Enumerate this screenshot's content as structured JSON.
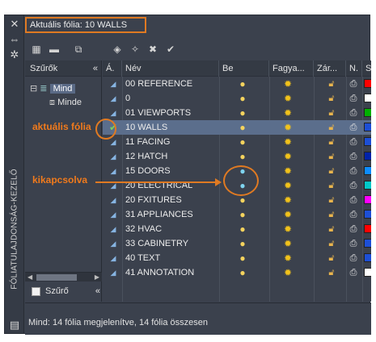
{
  "current_layer_label": "Aktuális fólia: 10 WALLS",
  "vertical_title": "FÓLIATULAJDONSÁG-KEZELŐ",
  "filters": {
    "header": "Szűrők",
    "collapse": "«",
    "tree": [
      {
        "label": "Mind",
        "selected": true
      },
      {
        "label": "Minde"
      }
    ],
    "invert_label": "Szűrő",
    "invert_collapse": "«"
  },
  "columns": [
    {
      "label": "Á."
    },
    {
      "label": "Név"
    },
    {
      "label": "Be"
    },
    {
      "label": "Fagya..."
    },
    {
      "label": "Zár..."
    },
    {
      "label": "N."
    },
    {
      "label": "Szí"
    }
  ],
  "layers": [
    {
      "name": "00 REFERENCE",
      "on": true,
      "color": "#ff0000",
      "current": false
    },
    {
      "name": "0",
      "on": true,
      "color": "#ffffff",
      "current": false
    },
    {
      "name": "01 VIEWPORTS",
      "on": true,
      "color": "#00b000",
      "current": false
    },
    {
      "name": "10 WALLS",
      "on": true,
      "color": "#1d4fd6",
      "current": true
    },
    {
      "name": "11 FACING",
      "on": true,
      "color": "#1d4fd6",
      "current": false
    },
    {
      "name": "12 HATCH",
      "on": true,
      "color": "#0022aa",
      "current": false
    },
    {
      "name": "15 DOORS",
      "on": false,
      "color": "#0d8cff",
      "current": false
    },
    {
      "name": "20 ELECTRICAL",
      "on": false,
      "color": "#00c8c8",
      "current": false
    },
    {
      "name": "20 FXITURES",
      "on": true,
      "color": "#ff00ff",
      "current": false
    },
    {
      "name": "31 APPLIANCES",
      "on": true,
      "color": "#1d4fd6",
      "current": false
    },
    {
      "name": "32 HVAC",
      "on": true,
      "color": "#ff0000",
      "current": false
    },
    {
      "name": "33 CABINETRY",
      "on": true,
      "color": "#1d4fd6",
      "current": false
    },
    {
      "name": "40 TEXT",
      "on": true,
      "color": "#1d4fd6",
      "current": false
    },
    {
      "name": "41 ANNOTATION",
      "on": true,
      "color": "#ffffff",
      "current": false
    }
  ],
  "status_text": "Mind: 14 fólia megjelenítve, 14 fólia összesen",
  "annotations": {
    "current": "aktuális fólia",
    "off": "kikapcsolva"
  },
  "colors": {
    "annotation": "#e07a22",
    "panel_bg": "#3b414d",
    "selected_row": "#5b6e8c"
  }
}
